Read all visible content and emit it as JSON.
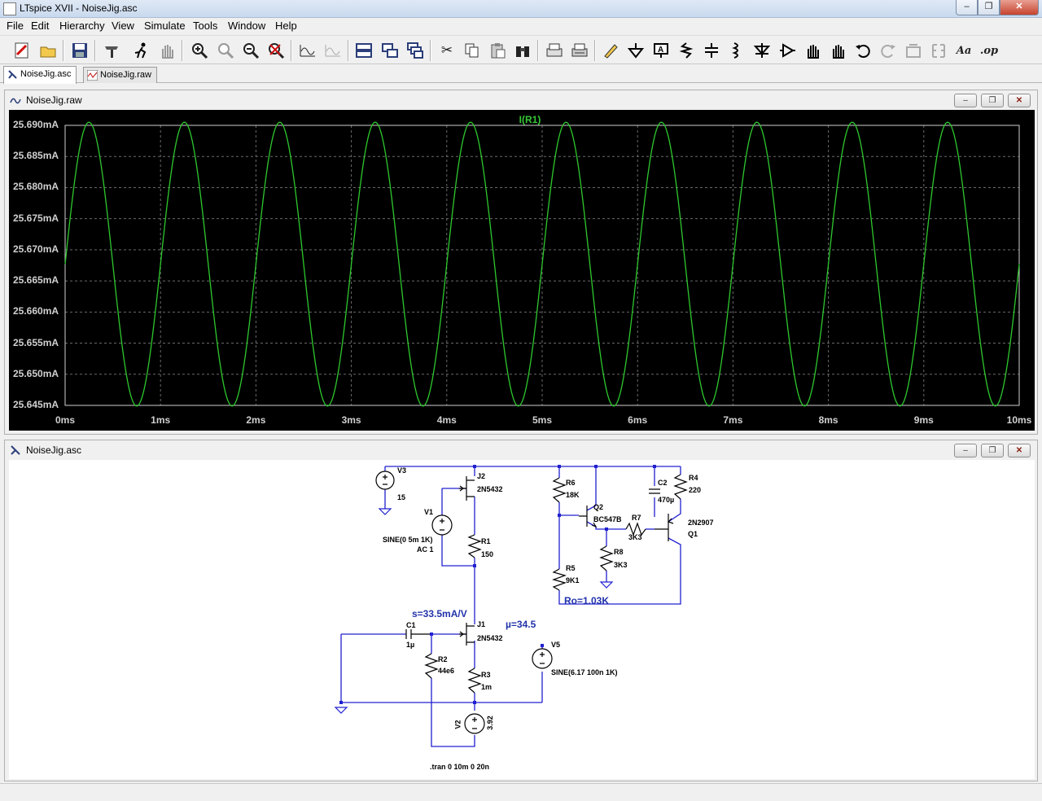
{
  "window": {
    "title": "LTspice XVII - NoiseJig.asc"
  },
  "menu": [
    "File",
    "Edit",
    "Hierarchy",
    "View",
    "Simulate",
    "Tools",
    "Window",
    "Help"
  ],
  "toolbar": {
    "text_tool": "Aa",
    "op_tool": ".op"
  },
  "tabs": [
    {
      "label": "NoiseJig.asc",
      "active": true
    },
    {
      "label": "NoiseJig.raw",
      "active": false
    }
  ],
  "plot_window": {
    "title": "NoiseJig.raw",
    "chart_data": {
      "type": "line",
      "title": "I(R1)",
      "x_ticks": [
        "0ms",
        "1ms",
        "2ms",
        "3ms",
        "4ms",
        "5ms",
        "6ms",
        "7ms",
        "8ms",
        "9ms",
        "10ms"
      ],
      "y_ticks": [
        "25.690mA",
        "25.685mA",
        "25.680mA",
        "25.675mA",
        "25.670mA",
        "25.665mA",
        "25.660mA",
        "25.655mA",
        "25.650mA",
        "25.645mA"
      ],
      "xlim": [
        0,
        10
      ],
      "ylim": [
        25.645,
        25.69
      ],
      "series": [
        {
          "name": "I(R1)",
          "color": "#2ec82e",
          "offset": 25.6677,
          "amplitude": 0.0228,
          "frequency_khz": 1.0,
          "phase_deg": 0
        }
      ],
      "grid": true,
      "background": "#000000"
    }
  },
  "schematic_window": {
    "title": "NoiseJig.asc",
    "labels": {
      "v3_name": "V3",
      "v3_value": "15",
      "j2_name": "J2",
      "j2_model": "2N5432",
      "v1_name": "V1",
      "v1_value": "SINE(0 5m 1K)",
      "v1_ac": "AC 1",
      "r1_name": "R1",
      "r1_value": "150",
      "r6_name": "R6",
      "r6_value": "18K",
      "q2_name": "Q2",
      "q2_model": "BC547B",
      "r7_name": "R7",
      "r7_value": "3K3",
      "r8_name": "R8",
      "r8_value": "3K3",
      "r5_name": "R5",
      "r5_value": "9K1",
      "c2_name": "C2",
      "c2_value": "470µ",
      "r4_name": "R4",
      "r4_value": "220",
      "q1_model": "2N2907",
      "q1_name": "Q1",
      "ro_note": "Ro=1.03K",
      "s_note": "s=33.5mA/V",
      "mu_note": "µ=34.5",
      "c1_name": "C1",
      "c1_value": "1µ",
      "j1_name": "J1",
      "j1_model": "2N5432",
      "r2_name": "R2",
      "r2_value": "44e6",
      "r3_name": "R3",
      "r3_value": "1m",
      "v5_name": "V5",
      "v5_value": "SINE(6.17 100n 1K)",
      "v2_name": "V2",
      "v2_value": "3.92",
      "tran": ".tran 0 10m 0 20n"
    }
  }
}
